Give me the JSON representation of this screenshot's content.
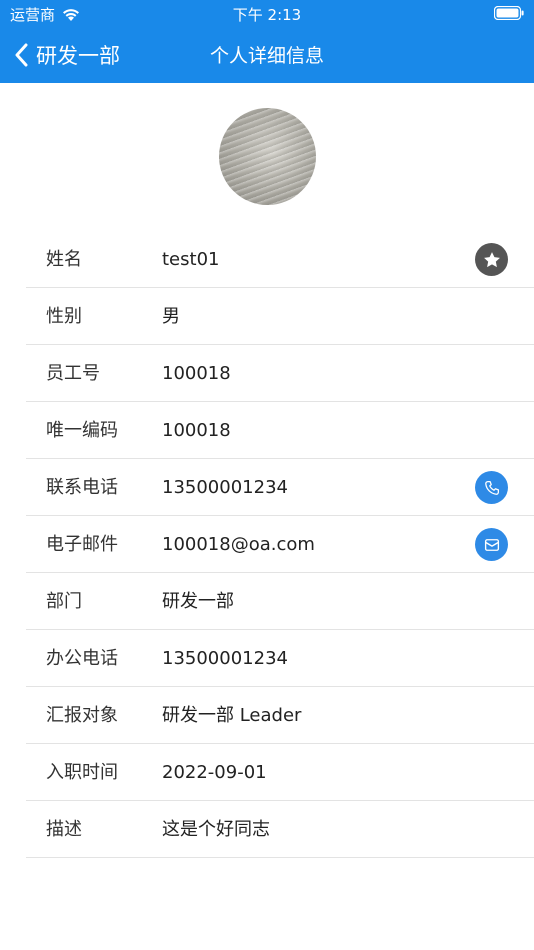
{
  "status_bar": {
    "carrier": "运营商",
    "time": "下午 2:13"
  },
  "nav": {
    "back_label": "研发一部",
    "title": "个人详细信息"
  },
  "colors": {
    "header_bg": "#1989e9",
    "action_blue": "#2e8ae6",
    "favorite_gray": "#555555",
    "divider": "#e3e3e3"
  },
  "fields": [
    {
      "label": "姓名",
      "value": "test01",
      "action": "star-icon"
    },
    {
      "label": "性别",
      "value": "男"
    },
    {
      "label": "员工号",
      "value": "100018"
    },
    {
      "label": "唯一编码",
      "value": "100018"
    },
    {
      "label": "联系电话",
      "value": "13500001234",
      "action": "phone-icon"
    },
    {
      "label": "电子邮件",
      "value": "100018@oa.com",
      "action": "mail-icon"
    },
    {
      "label": "部门",
      "value": "研发一部"
    },
    {
      "label": "办公电话",
      "value": "13500001234"
    },
    {
      "label": "汇报对象",
      "value": "研发一部 Leader"
    },
    {
      "label": "入职时间",
      "value": "2022-09-01"
    },
    {
      "label": "描述",
      "value": "这是个好同志"
    }
  ]
}
